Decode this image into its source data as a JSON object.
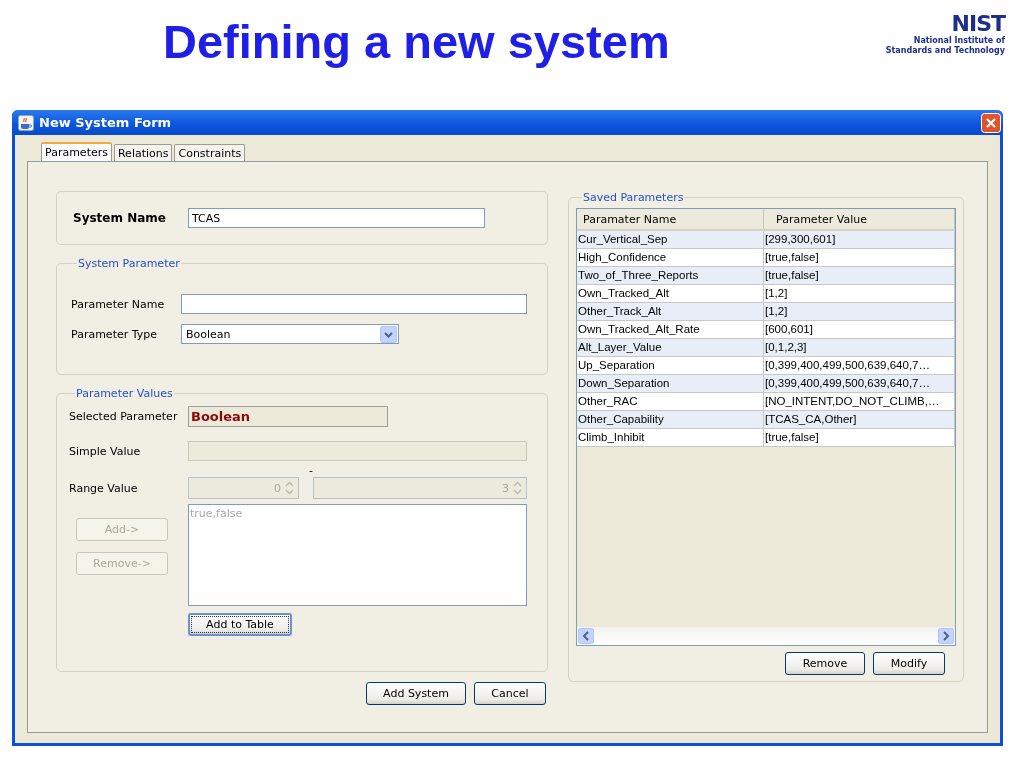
{
  "slide": {
    "title": "Defining a new system",
    "logo": {
      "wordmark": "NIST",
      "lines": [
        "National Institute of",
        "Standards and Technology"
      ]
    }
  },
  "window": {
    "title": "New System Form"
  },
  "tabs": [
    {
      "label": "Parameters",
      "selected": true
    },
    {
      "label": "Relations",
      "selected": false
    },
    {
      "label": "Constraints",
      "selected": false
    }
  ],
  "system_name": {
    "label": "System Name",
    "value": "TCAS"
  },
  "system_parameter": {
    "title": "System Parameter",
    "name_label": "Parameter Name",
    "type_label": "Parameter Type",
    "type_value": "Boolean"
  },
  "parameter_values": {
    "title": "Parameter Values",
    "selected_label": "Selected Parameter",
    "selected_value": "Boolean",
    "simple_label": "Simple Value",
    "simple_disabled": true,
    "range_label": "Range Value",
    "range_separator": "-",
    "range_disabled": true,
    "range_from": "0",
    "range_to": "3",
    "values_text": "true,false",
    "values_disabled": true,
    "side_buttons": [
      {
        "label": "Add->",
        "disabled": true
      },
      {
        "label": "Remove->",
        "disabled": true
      }
    ],
    "add_button": "Add to Table"
  },
  "saved_parameters": {
    "title": "Saved Parameters",
    "columns": [
      "Paramater Name",
      "Parameter Value"
    ],
    "rows": [
      [
        "Cur_Vertical_Sep",
        "[299,300,601]"
      ],
      [
        "High_Confidence",
        "[true,false]"
      ],
      [
        "Two_of_Three_Reports",
        "[true,false]"
      ],
      [
        "Own_Tracked_Alt",
        "[1,2]"
      ],
      [
        "Other_Track_Alt",
        "[1,2]"
      ],
      [
        "Own_Tracked_Alt_Rate",
        "[600,601]"
      ],
      [
        "Alt_Layer_Value",
        "[0,1,2,3]"
      ],
      [
        "Up_Separation",
        "[0,399,400,499,500,639,640,7…"
      ],
      [
        "Down_Separation",
        "[0,399,400,499,500,639,640,7…"
      ],
      [
        "Other_RAC",
        "[NO_INTENT,DO_NOT_CLIMB,…"
      ],
      [
        "Other_Capability",
        "[TCAS_CA,Other]"
      ],
      [
        "Climb_Inhibit",
        "[true,false]"
      ]
    ],
    "buttons": [
      "Remove",
      "Modify"
    ]
  },
  "buttons": [
    "Add System",
    "Cancel"
  ]
}
